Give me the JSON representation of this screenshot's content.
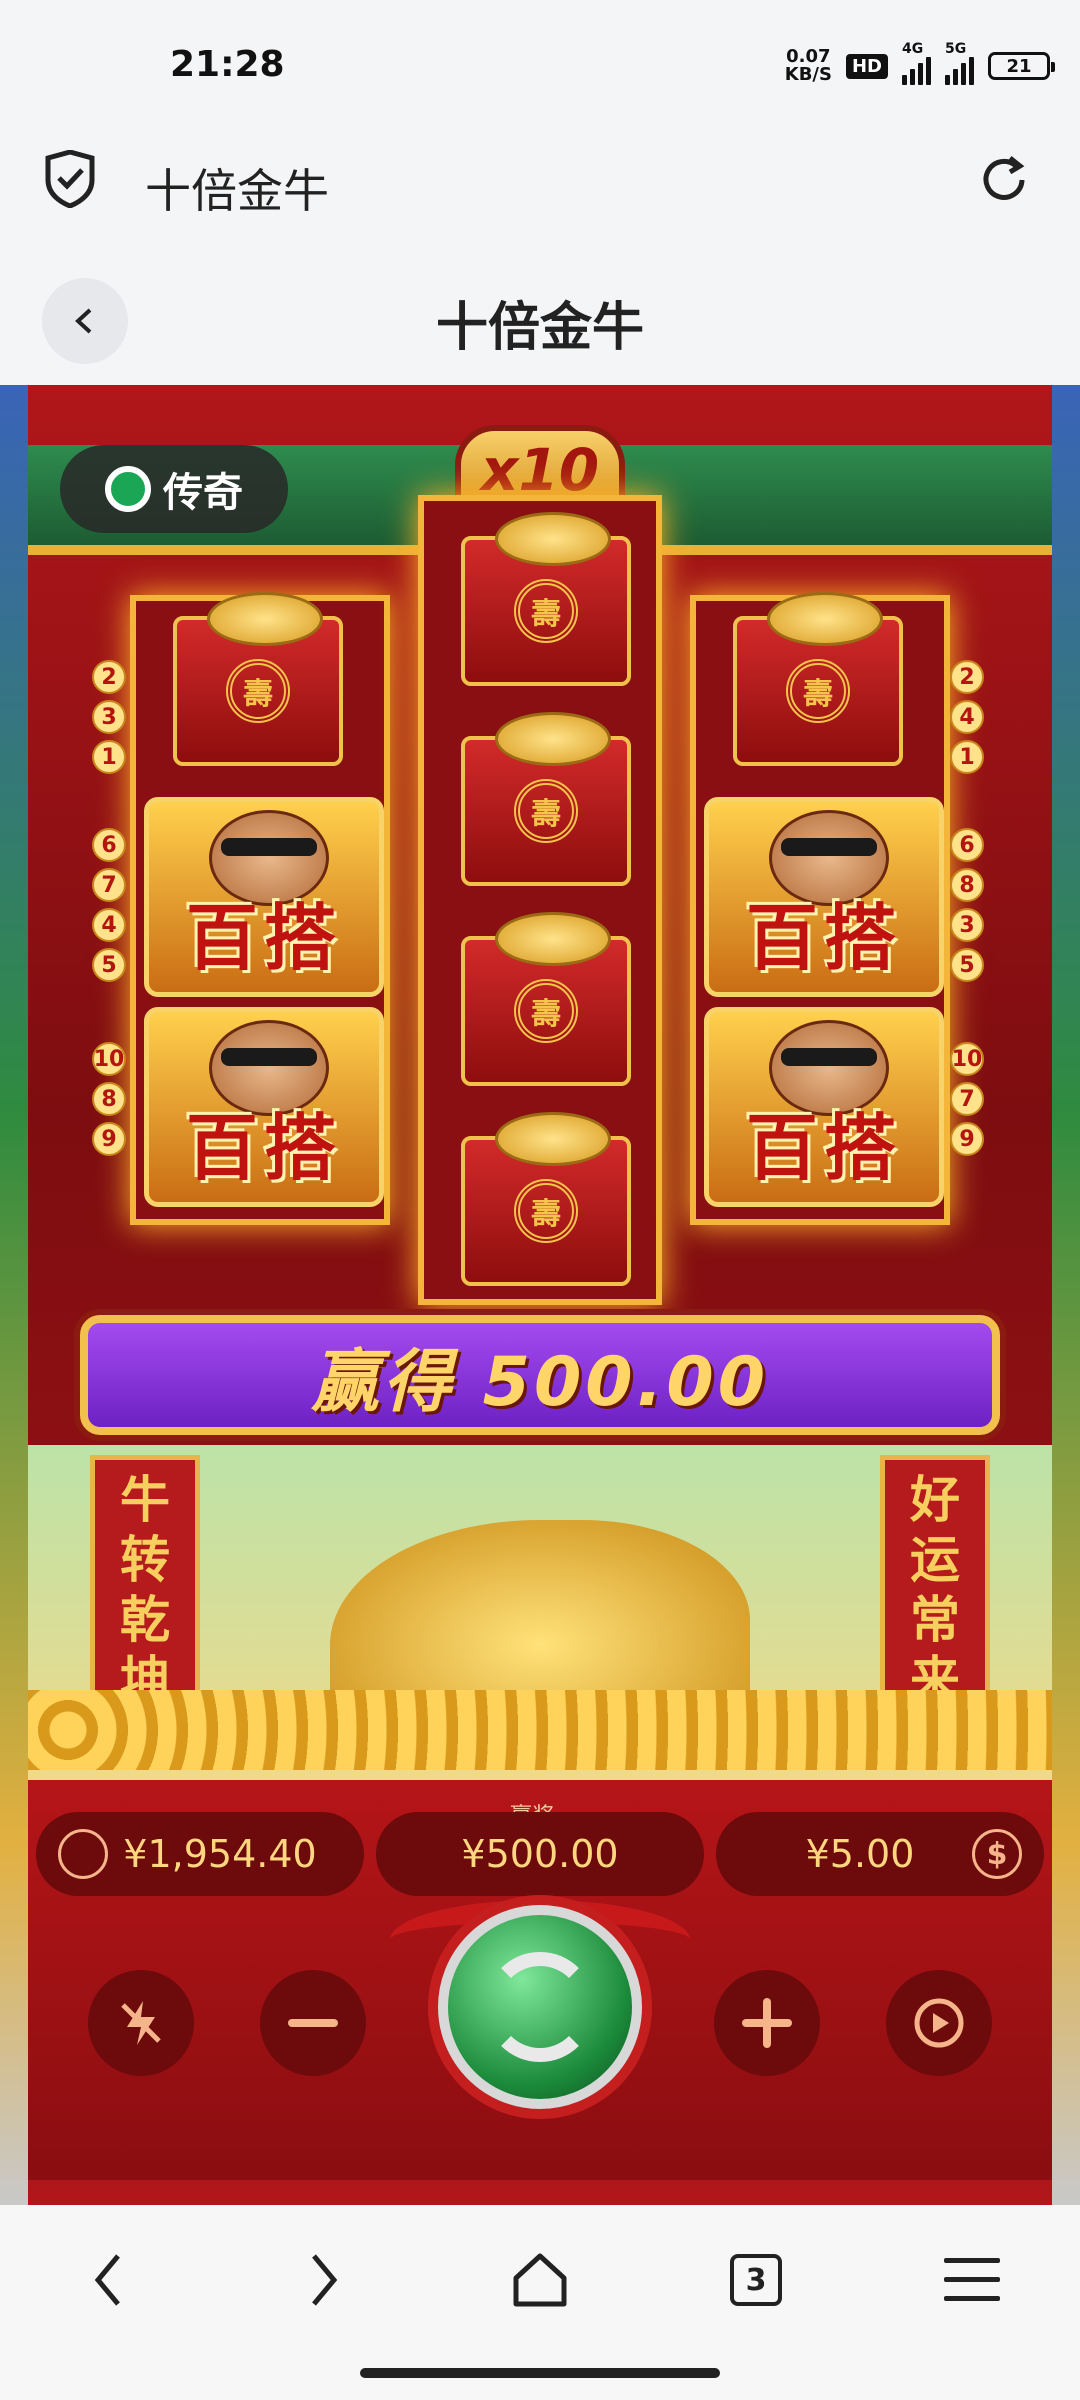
{
  "status": {
    "time": "21:28",
    "netspeed": "0.07",
    "netspeed_unit": "KB/S",
    "hd": "HD",
    "sig1": "4G",
    "sig2": "5G",
    "battery": "21"
  },
  "browser": {
    "address_title": "十倍金牛"
  },
  "header": {
    "title": "十倍金牛"
  },
  "game": {
    "logo": "传奇",
    "multiplier": "x10",
    "left_lines_top": [
      "2",
      "3",
      "1"
    ],
    "left_lines_mid": [
      "6",
      "7",
      "4",
      "5"
    ],
    "left_lines_bot": [
      "10",
      "8",
      "9"
    ],
    "right_lines_top": [
      "2",
      "4",
      "1"
    ],
    "right_lines_mid": [
      "6",
      "8",
      "3",
      "5"
    ],
    "right_lines_bot": [
      "10",
      "7",
      "9"
    ],
    "wild_label": "百搭",
    "envelope_glyph": "壽",
    "win_text": "赢得 500.00",
    "banner_left": [
      "牛",
      "转",
      "乾",
      "坤"
    ],
    "banner_right": [
      "好",
      "运",
      "常",
      "来"
    ],
    "balance": "¥1,954.40",
    "win_label": "赢奖",
    "win_amount": "¥500.00",
    "bet": "¥5.00"
  },
  "nav": {
    "tab_count": "3"
  }
}
